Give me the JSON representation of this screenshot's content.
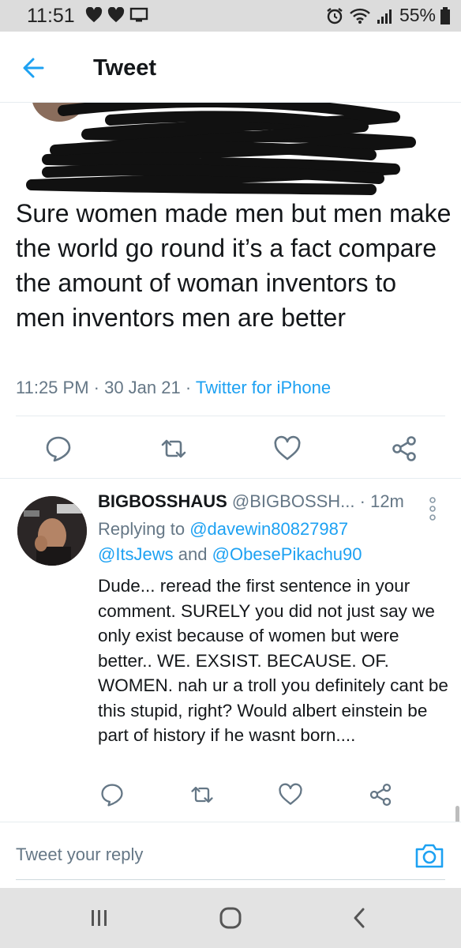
{
  "status_bar": {
    "time": "11:51",
    "battery": "55%"
  },
  "header": {
    "title": "Tweet"
  },
  "main_tweet": {
    "text": "Sure women made men but men make the world go round it’s a fact compare the amount of woman inventors to men inventors men are better",
    "time": "11:25 PM · 30 Jan 21 · ",
    "source": "Twitter for iPhone"
  },
  "reply": {
    "name": "BIGBOSSHAUS",
    "handle": "@BIGBOSSH...",
    "time": "· 12m",
    "replying_prefix": "Replying to ",
    "mention_1": "@davewin80827987",
    "mention_2": "@ItsJews",
    "and_text": " and ",
    "mention_3": "@ObesePikachu90",
    "body": "Dude... reread the first sentence in your comment. SURELY you did not just say we only exist because of women but were better.. WE. EXSIST. BECAUSE. OF. WOMEN. nah ur a troll you definitely cant be this stupid, right? Would albert einstein be part of history if he wasnt born...."
  },
  "composer": {
    "placeholder": "Tweet your reply"
  },
  "icons": {
    "accent": "#1da1f2",
    "muted": "#657786"
  }
}
